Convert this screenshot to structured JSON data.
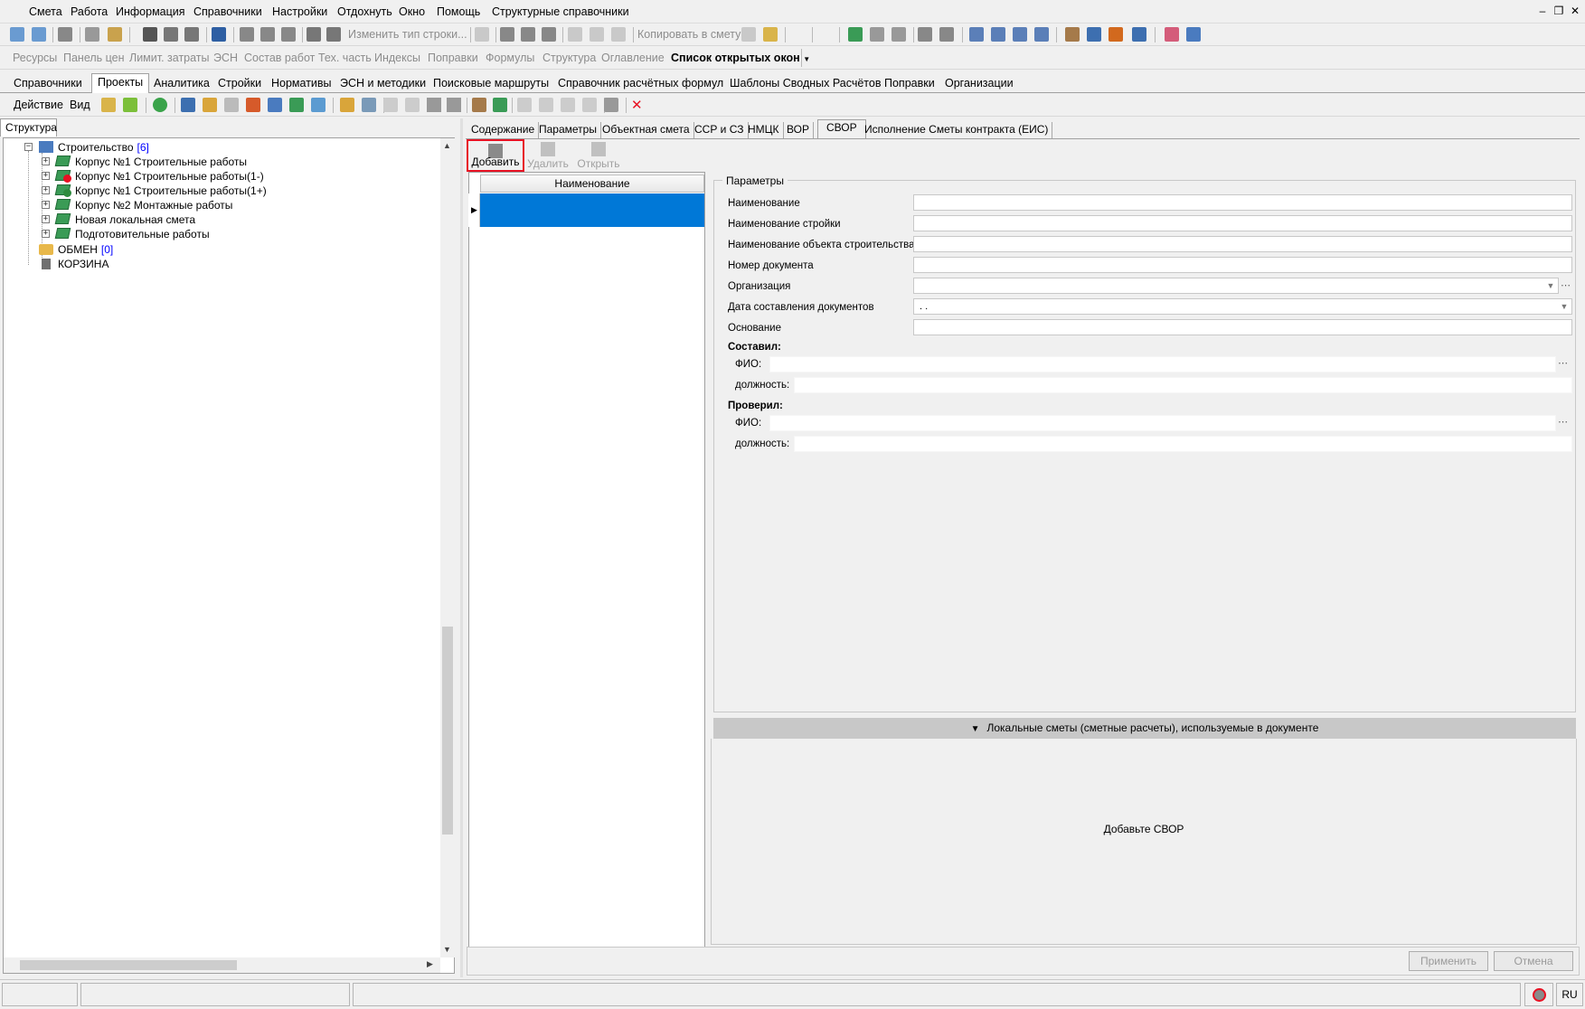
{
  "menu": {
    "items": [
      "Смета",
      "Работа",
      "Информация",
      "Справочники",
      "Настройки",
      "Отдохнуть",
      "Окно",
      "Помощь",
      "Структурные справочники"
    ]
  },
  "toolbar1": {
    "change_row_type": "Изменить тип строки...",
    "copy_to_smeta": "Копировать в смету"
  },
  "toolbar2": {
    "items": [
      "Ресурсы",
      "Панель цен",
      "Лимит. затраты",
      "ЭСН",
      "Состав работ",
      "Тех. часть",
      "Индексы",
      "Поправки",
      "Формулы",
      "Структура",
      "Оглавление"
    ],
    "open_windows": "Список открытых окон"
  },
  "nav_tabs": [
    "Справочники",
    "Проекты",
    "Аналитика",
    "Стройки",
    "Нормативы",
    "ЭСН и методики",
    "Поисковые маршруты",
    "Справочник расчётных формул",
    "Шаблоны Сводных Расчётов",
    "Поправки",
    "Организации"
  ],
  "toolbar4": {
    "action": "Действие",
    "view": "Вид"
  },
  "left_panel": {
    "tab": "Структура",
    "root": {
      "label": "Строительство",
      "count": "[6]"
    },
    "children": [
      "Корпус №1 Строительные работы",
      "Корпус №1 Строительные работы(1-)",
      "Корпус №1 Строительные работы(1+)",
      "Корпус №2 Монтажные работы",
      "Новая локальная смета",
      "Подготовительные работы"
    ],
    "exchange": {
      "label": "ОБМЕН",
      "count": "[0]"
    },
    "trash": "КОРЗИНА"
  },
  "right_tabs": [
    "Содержание",
    "Параметры",
    "Объектная смета",
    "ССР и СЗ",
    "НМЦК",
    "ВОР",
    "СВОР",
    "Исполнение Сметы контракта (ЕИС)"
  ],
  "actions": {
    "add": "Добавить",
    "delete": "Удалить",
    "open": "Открыть"
  },
  "list": {
    "header": "Наименование"
  },
  "params": {
    "legend": "Параметры",
    "name": "Наименование",
    "construction_name": "Наименование стройки",
    "object_name": "Наименование объекта строительства",
    "doc_number": "Номер документа",
    "organization": "Организация",
    "doc_date": "Дата составления документов",
    "doc_date_value": " . .",
    "basis": "Основание",
    "composed": "Составил:",
    "checked": "Проверил:",
    "fio": "ФИО:",
    "position": "должность:"
  },
  "local_smeta": {
    "bar": "Локальные сметы (сметные расчеты), используемые в документе",
    "empty": "Добавьте СВОР"
  },
  "buttons": {
    "apply": "Применить",
    "cancel": "Отмена"
  },
  "status": {
    "lang": "RU"
  },
  "colors": {
    "selection": "#0078d7",
    "highlight": "#e81123"
  }
}
